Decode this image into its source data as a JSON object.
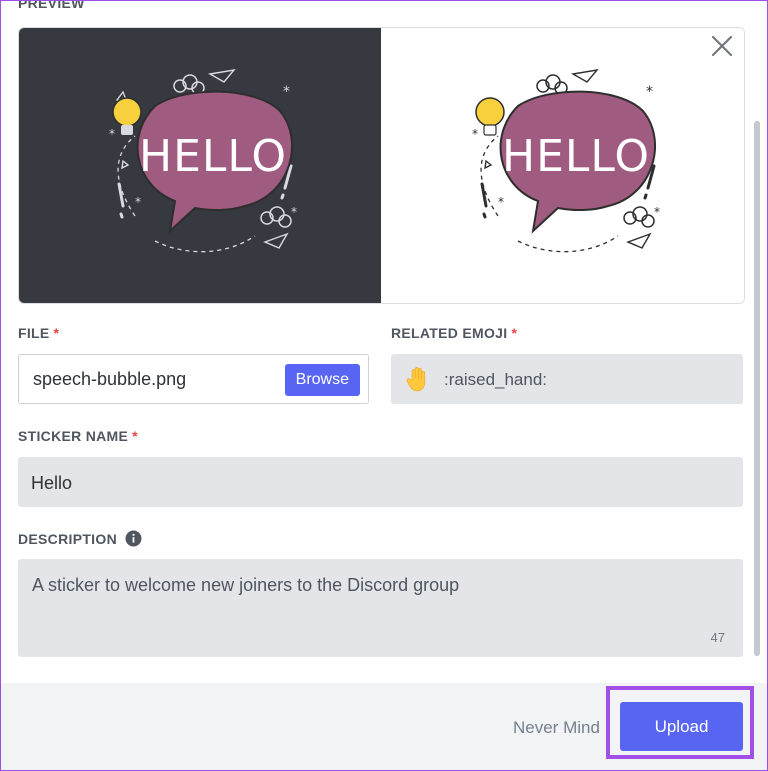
{
  "preview": {
    "label": "PREVIEW",
    "sticker_text": "HELLO",
    "dark_bg": "#36393f",
    "light_bg": "#ffffff",
    "bubble_color": "#a05b80",
    "bulb_color": "#f7d13d"
  },
  "close_icon": "close-icon",
  "file": {
    "label": "FILE",
    "required_mark": "*",
    "value": "speech-bubble.png",
    "browse_label": "Browse"
  },
  "related_emoji": {
    "label": "RELATED EMOJI",
    "required_mark": "*",
    "emoji_icon": "raised-hand-icon",
    "value": ":raised_hand:"
  },
  "sticker_name": {
    "label": "STICKER NAME",
    "required_mark": "*",
    "value": "Hello"
  },
  "description": {
    "label": "DESCRIPTION",
    "info_icon": "info-icon",
    "value": "A sticker to welcome new joiners to the Discord group",
    "char_count": "47"
  },
  "footer": {
    "cancel_label": "Never Mind",
    "upload_label": "Upload"
  },
  "colors": {
    "accent": "#5865f2",
    "required": "#ed4245",
    "highlight": "#a14fe8",
    "input_bg": "#e3e5e8"
  }
}
